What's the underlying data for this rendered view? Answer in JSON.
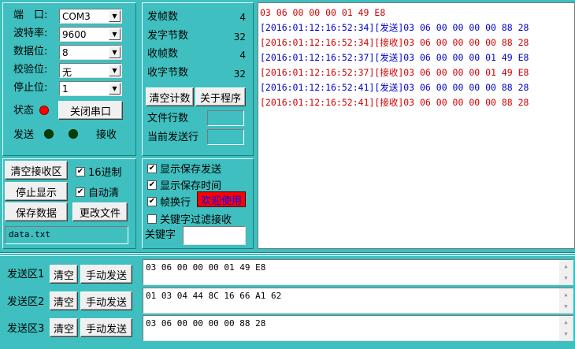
{
  "port": {
    "port_label": "端　口:",
    "port_value": "COM3",
    "baud_label": "波特率:",
    "baud_value": "9600",
    "databits_label": "数据位:",
    "databits_value": "8",
    "parity_label": "校验位:",
    "parity_value": "无",
    "stopbits_label": "停止位:",
    "stopbits_value": "1",
    "status_label": "状态",
    "close_port_label": "关闭串口",
    "send_led_label": "发送",
    "recv_led_label": "接收"
  },
  "stats": {
    "tx_frames_label": "发帧数",
    "tx_frames": "4",
    "tx_bytes_label": "发字节数",
    "tx_bytes": "32",
    "rx_frames_label": "收帧数",
    "rx_frames": "4",
    "rx_bytes_label": "收字节数",
    "rx_bytes": "32",
    "clear_count_label": "清空计数",
    "about_label": "关于程序",
    "file_lines_label": "文件行数",
    "current_line_label": "当前发送行"
  },
  "recv_controls": {
    "clear_recv_label": "清空接收区",
    "hex_label": "16进制",
    "stop_display_label": "停止显示",
    "auto_clear_label": "自动清",
    "save_data_label": "保存数据",
    "change_file_label": "更改文件",
    "filename": "data.txt"
  },
  "options": {
    "show_save_send_label": "显示保存发送",
    "show_save_time_label": "显示保存时间",
    "frame_newline_label": "帧换行",
    "welcome_label": "欢迎使用",
    "keyword_filter_label": "关键字过滤接收",
    "keyword_label": "关键字",
    "keyword_value": ""
  },
  "log": {
    "lines": [
      {
        "text": "03 06 00 00 00 01 49 E8",
        "color": "#d00000"
      },
      {
        "text": "[2016:01:12:16:52:34][发送]03 06 00 00 00 00 88 28",
        "color": "#0000c8"
      },
      {
        "text": "[2016:01:12:16:52:34][接收]03 06 00 00 00 00 88 28",
        "color": "#d00000"
      },
      {
        "text": "[2016:01:12:16:52:37][发送]03 06 00 00 00 01 49 E8",
        "color": "#0000c8"
      },
      {
        "text": "[2016:01:12:16:52:37][接收]03 06 00 00 00 01 49 E8",
        "color": "#d00000"
      },
      {
        "text": "[2016:01:12:16:52:41][发送]03 06 00 00 00 00 88 28",
        "color": "#0000c8"
      },
      {
        "text": "[2016:01:12:16:52:41][接收]03 06 00 00 00 00 88 28",
        "color": "#d00000"
      }
    ]
  },
  "send": {
    "areas": [
      {
        "label": "发送区1",
        "clear": "清空",
        "manual": "手动发送",
        "content": "03 06 00 00 00 01 49 E8"
      },
      {
        "label": "发送区2",
        "clear": "清空",
        "manual": "手动发送",
        "content": "01 03 04 44 8C 16 66 A1 62"
      },
      {
        "label": "发送区3",
        "clear": "清空",
        "manual": "手动发送",
        "content": "03 06 00 00 00 00 88 28"
      }
    ]
  },
  "colors": {
    "background": "#3fbfbf",
    "status_led": "#ff0000",
    "idle_led": "#004000",
    "welcome_bg": "#ff0000",
    "welcome_fg": "#0000ff"
  }
}
